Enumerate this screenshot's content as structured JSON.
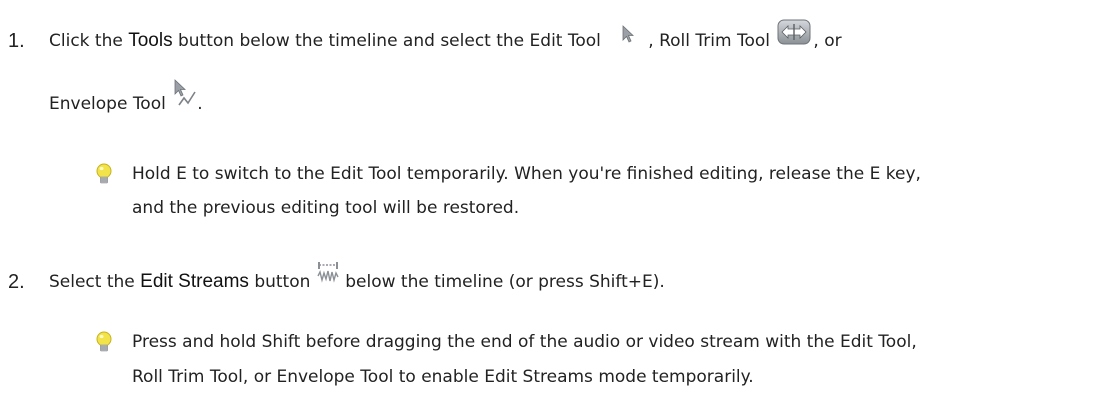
{
  "steps": [
    {
      "number": "1.",
      "t1": "Click the ",
      "ui1": "Tools",
      "t2": " button below the timeline and select the Edit Tool",
      "t3": ", Roll Trim Tool",
      "t4": ", or",
      "t5": "Envelope Tool",
      "t6": ".",
      "tip": {
        "line1": "Hold E to switch to the Edit Tool temporarily. When you're finished editing, release the E key,",
        "line2": "and the previous editing tool will be restored."
      }
    },
    {
      "number": "2.",
      "t1": "Select the ",
      "ui1": "Edit Streams",
      "t2": " button",
      "t3": " below the timeline (or press Shift+E).",
      "tip": {
        "line1": "Press and hold Shift before dragging the end of the audio or video stream with the Edit Tool,",
        "line2": "Roll Trim Tool, or Envelope Tool to enable Edit Streams mode temporarily."
      }
    }
  ],
  "icons": {
    "edit_tool": "edit-tool-arrow-icon",
    "roll_trim_tool": "roll-trim-tool-icon",
    "envelope_tool": "envelope-tool-icon",
    "edit_streams": "edit-streams-icon",
    "tip": "lightbulb-icon"
  }
}
